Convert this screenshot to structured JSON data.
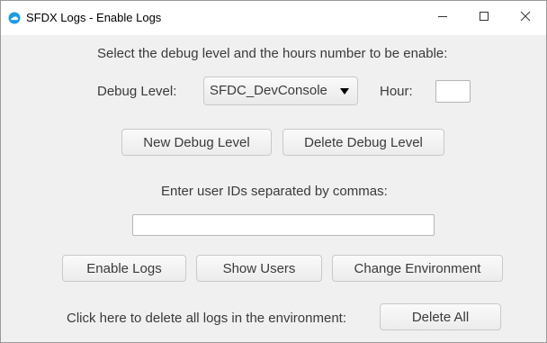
{
  "window": {
    "title": "SFDX Logs - Enable Logs",
    "controls": {
      "minimize_icon": "minimize-icon",
      "maximize_icon": "maximize-icon",
      "close_icon": "close-icon"
    }
  },
  "main": {
    "instruction": "Select the debug level and the hours number to be enable:",
    "debug_level_label": "Debug Level:",
    "debug_level_value": "SFDC_DevConsole",
    "hour_label": "Hour:",
    "hour_value": "",
    "new_debug_level_button": "New Debug Level",
    "delete_debug_level_button": "Delete Debug Level",
    "user_ids_label": "Enter user IDs separated by commas:",
    "user_ids_value": "",
    "enable_logs_button": "Enable Logs",
    "show_users_button": "Show Users",
    "change_environment_button": "Change Environment",
    "delete_all_label": "Click here to delete all logs in the environment:",
    "delete_all_button": "Delete All"
  },
  "colors": {
    "window_background": "#f0f0f0",
    "titlebar_background": "#ffffff",
    "app_icon": "#1e9be0"
  }
}
